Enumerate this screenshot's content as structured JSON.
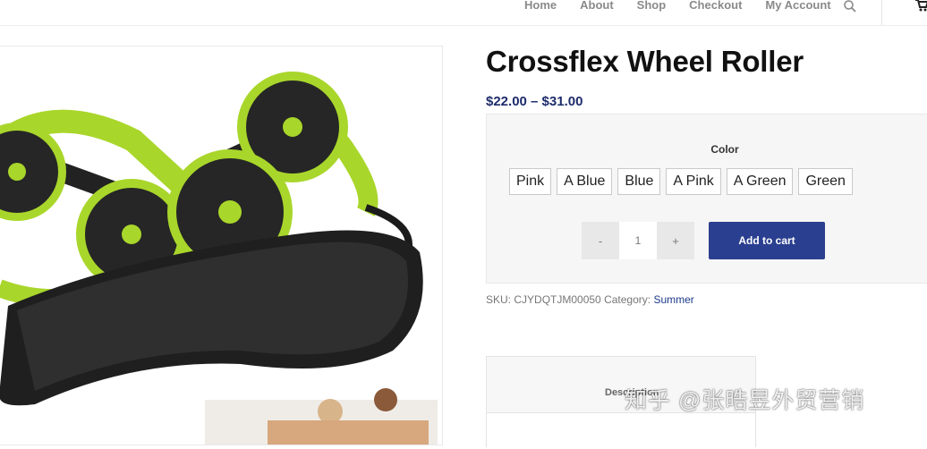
{
  "nav": {
    "items": [
      "Home",
      "About",
      "Shop",
      "Checkout",
      "My Account"
    ],
    "search_icon": "search-icon",
    "cart_icon": "cart-icon"
  },
  "product": {
    "title": "Crossflex Wheel Roller",
    "price": "$22.00 – $31.00",
    "image_icon": "product-photo"
  },
  "variations": {
    "label": "Color",
    "options": [
      "Pink",
      "A Blue",
      "Blue",
      "A Pink",
      "A Green",
      "Green"
    ]
  },
  "cart": {
    "minus": "-",
    "quantity": "1",
    "plus": "+",
    "add_label": "Add to cart"
  },
  "meta": {
    "sku_label": "SKU:",
    "sku": "CJYDQTJM00050",
    "category_label": "Category:",
    "category": "Summer"
  },
  "tabs": {
    "description": "Description"
  },
  "watermark": "知乎 @张晧昱外贸营销",
  "colors": {
    "accent": "#2a3f8f",
    "price": "#1d2c6b",
    "lime": "#a9d62b"
  }
}
